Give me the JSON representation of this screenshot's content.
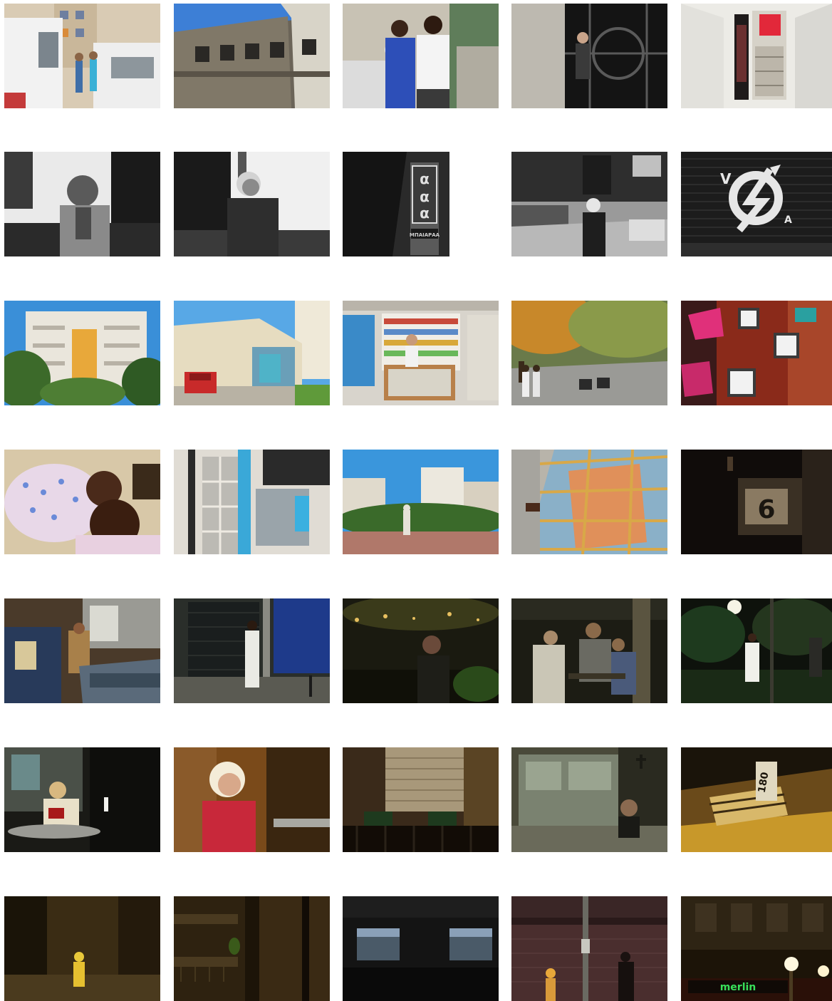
{
  "grid": {
    "columns": 5,
    "rows": 7
  },
  "photos": [
    {
      "row": 1,
      "col": 1,
      "subject": "street with white vans and men"
    },
    {
      "row": 1,
      "col": 2,
      "subject": "old concrete building facade"
    },
    {
      "row": 1,
      "col": 3,
      "subject": "two men portrait on street"
    },
    {
      "row": 1,
      "col": 4,
      "subject": "old man behind ornate gate"
    },
    {
      "row": 1,
      "col": 5,
      "subject": "white hallway with red stairway"
    },
    {
      "row": 2,
      "col": 1,
      "subject": "bearded man in park (b&w)"
    },
    {
      "row": 2,
      "col": 2,
      "subject": "older woman in park (b&w)"
    },
    {
      "row": 2,
      "col": 3,
      "subject": "vertical shop sign (b&w)"
    },
    {
      "row": 2,
      "col": 4,
      "subject": "woman walking on street (b&w)"
    },
    {
      "row": 2,
      "col": 5,
      "subject": "anarchist graffiti on shutter (b&w)"
    },
    {
      "row": 3,
      "col": 1,
      "subject": "apartment building with trees"
    },
    {
      "row": 3,
      "col": 2,
      "subject": "corner building with red car"
    },
    {
      "row": 3,
      "col": 3,
      "subject": "kiosk shopkeeper"
    },
    {
      "row": 3,
      "col": 4,
      "subject": "square with walking women"
    },
    {
      "row": 3,
      "col": 5,
      "subject": "overhead view of red interior"
    },
    {
      "row": 4,
      "col": 1,
      "subject": "mother and child"
    },
    {
      "row": 4,
      "col": 2,
      "subject": "blue-framed windows facade"
    },
    {
      "row": 4,
      "col": 3,
      "subject": "square with statue"
    },
    {
      "row": 4,
      "col": 4,
      "subject": "reflection of building in window"
    },
    {
      "row": 4,
      "col": 5,
      "subject": "house number plaque at night"
    },
    {
      "row": 5,
      "col": 1,
      "subject": "man at dumpster by car"
    },
    {
      "row": 5,
      "col": 2,
      "subject": "man in white walking at night"
    },
    {
      "row": 5,
      "col": 3,
      "subject": "man smoking at night"
    },
    {
      "row": 5,
      "col": 4,
      "subject": "men at cafe table at night"
    },
    {
      "row": 5,
      "col": 5,
      "subject": "woman in park at night"
    },
    {
      "row": 6,
      "col": 1,
      "subject": "woman at cafe table"
    },
    {
      "row": 6,
      "col": 2,
      "subject": "blonde woman in red"
    },
    {
      "row": 6,
      "col": 3,
      "subject": "balcony with plants at night"
    },
    {
      "row": 6,
      "col": 4,
      "subject": "man behind window"
    },
    {
      "row": 6,
      "col": 5,
      "subject": "building number sign at night"
    },
    {
      "row": 7,
      "col": 1,
      "subject": "figure in yellow at night street"
    },
    {
      "row": 7,
      "col": 2,
      "subject": "balconies at night"
    },
    {
      "row": 7,
      "col": 3,
      "subject": "lit windows at night"
    },
    {
      "row": 7,
      "col": 4,
      "subject": "people by shuttered shop at night"
    },
    {
      "row": 7,
      "col": 5,
      "subject": "street lamps and neon sign"
    }
  ],
  "signs": {
    "shop_vertical": "ΜΠΑΙΑΡΑΑ",
    "house_number": "6",
    "building_number": "180",
    "neon": "merlin"
  },
  "colors": {
    "background": "#ffffff",
    "sky_blue": "#3a8fd8",
    "night": "#1b1712",
    "neon_green": "#38e05a"
  }
}
